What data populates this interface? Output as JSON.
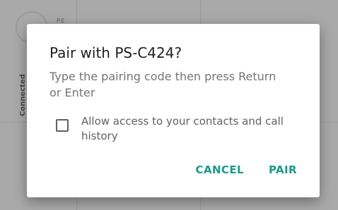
{
  "background": {
    "small_text": "P.E",
    "vertical_text": "Connected"
  },
  "dialog": {
    "title": "Pair with PS-C424?",
    "message": "Type the pairing code then press Return or Enter",
    "checkbox": {
      "label": "Allow access to your contacts and call history",
      "checked": false
    },
    "buttons": {
      "cancel": "CANCEL",
      "pair": "PAIR"
    }
  },
  "colors": {
    "accent": "#1a9a8a",
    "scrim": "#a9a9a9",
    "dialog_bg": "#ffffff"
  }
}
